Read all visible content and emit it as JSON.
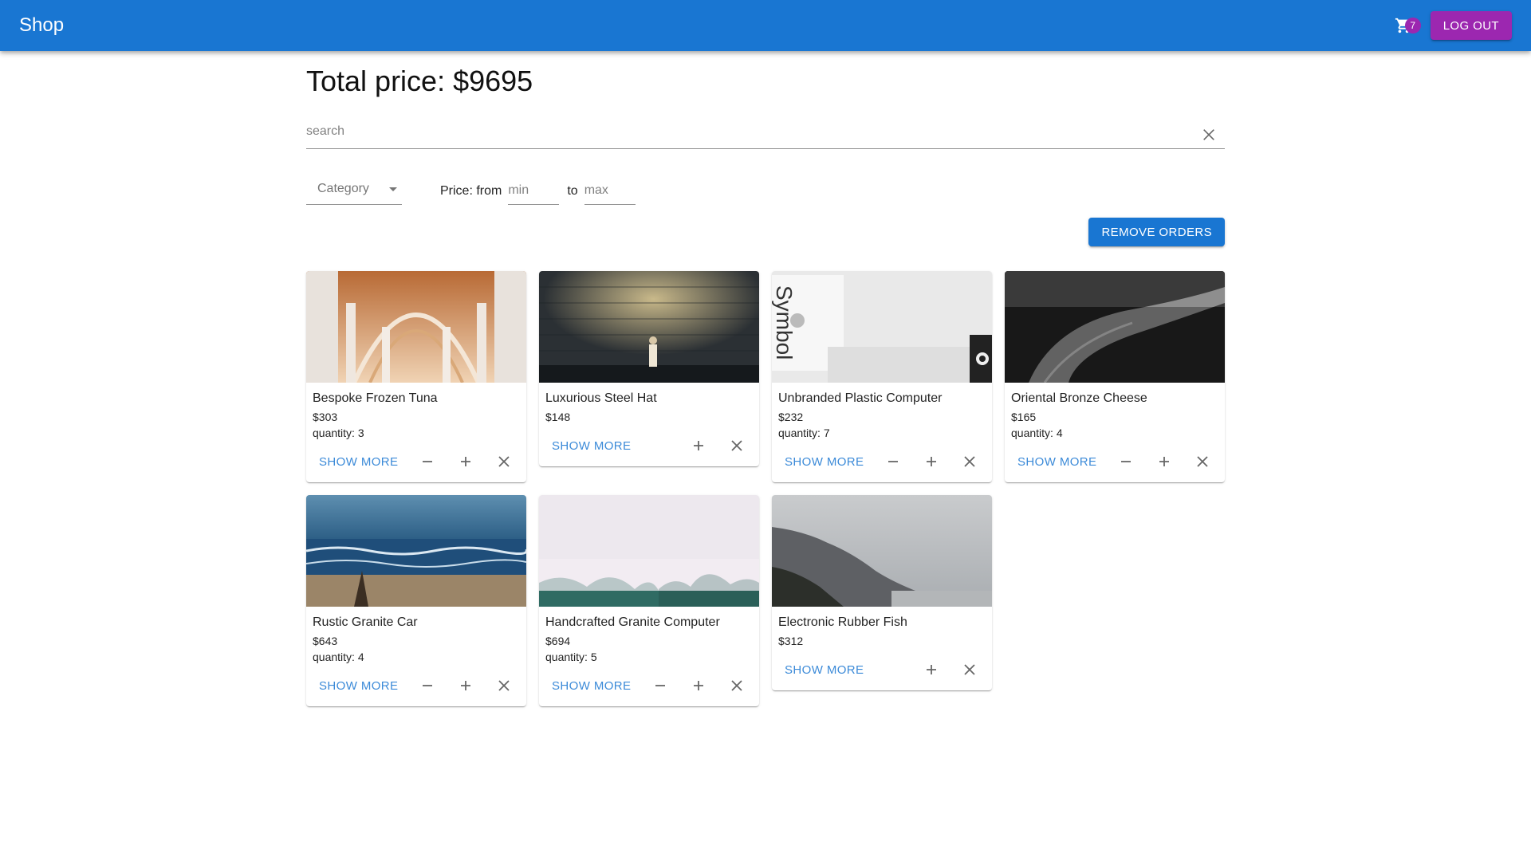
{
  "appbar": {
    "title": "Shop",
    "cart_count": "7",
    "logout_label": "LOG OUT"
  },
  "summary": {
    "label": "Total price:",
    "value": "$9695"
  },
  "search": {
    "placeholder": "search",
    "value": ""
  },
  "filters": {
    "category_placeholder": "Category",
    "price_label": "Price: from",
    "min_placeholder": "min",
    "to_label": "to",
    "max_placeholder": "max"
  },
  "remove_orders_label": "REMOVE ORDERS",
  "show_more_label": "SHOW MORE",
  "qty_prefix": "quantity:",
  "products": [
    {
      "name": "Bespoke Frozen Tuna",
      "price": "$303",
      "quantity": "3",
      "image": "cathedral-arches"
    },
    {
      "name": "Luxurious Steel Hat",
      "price": "$148",
      "quantity": null,
      "image": "child-by-stone-wall"
    },
    {
      "name": "Unbranded Plastic Computer",
      "price": "$232",
      "quantity": "7",
      "image": "white-product-boxes"
    },
    {
      "name": "Oriental Bronze Cheese",
      "price": "$165",
      "quantity": "4",
      "image": "dark-forest-road"
    },
    {
      "name": "Rustic Granite Car",
      "price": "$643",
      "quantity": "4",
      "image": "ocean-beach"
    },
    {
      "name": "Handcrafted Granite Computer",
      "price": "$694",
      "quantity": "5",
      "image": "misty-forest"
    },
    {
      "name": "Electronic Rubber Fish",
      "price": "$312",
      "quantity": null,
      "image": "mountain-coast"
    }
  ],
  "colors": {
    "primary": "#1976d2",
    "secondary": "#9c27b0"
  }
}
